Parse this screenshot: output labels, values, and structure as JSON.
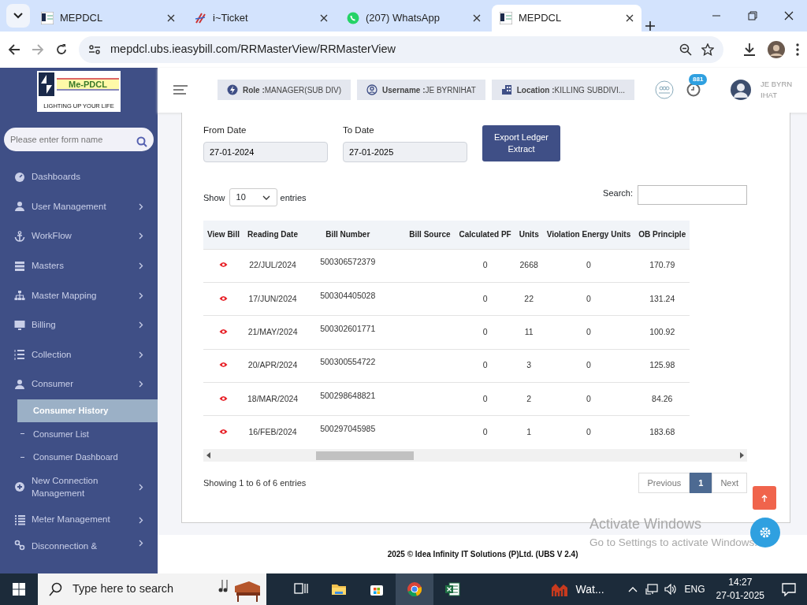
{
  "browser": {
    "tabs": [
      {
        "title": "MEPDCL",
        "selected": false
      },
      {
        "title": "i~Ticket",
        "selected": false
      },
      {
        "title": "(207) WhatsApp",
        "selected": false
      },
      {
        "title": "MEPDCL",
        "selected": true
      }
    ],
    "url": "mepdcl.ubs.ieasybill.com/RRMasterView/RRMasterView"
  },
  "sidebar": {
    "logo_text": "Me-PDCL",
    "logo_tagline": "LIGHTING UP YOUR LIFE",
    "search_placeholder": "Please enter form name",
    "items": [
      {
        "label": "Dashboards",
        "has_submenu": false
      },
      {
        "label": "User Management",
        "has_submenu": true
      },
      {
        "label": "WorkFlow",
        "has_submenu": true
      },
      {
        "label": "Masters",
        "has_submenu": true
      },
      {
        "label": "Master Mapping",
        "has_submenu": true
      },
      {
        "label": "Billing",
        "has_submenu": true
      },
      {
        "label": "Collection",
        "has_submenu": true
      },
      {
        "label": "Consumer",
        "has_submenu": true,
        "expanded": true,
        "children": [
          {
            "label": "Consumer History",
            "selected": true
          },
          {
            "label": "Consumer List",
            "selected": false
          },
          {
            "label": "Consumer Dashboard",
            "selected": false
          }
        ]
      },
      {
        "label": "New Connection Management",
        "has_submenu": true
      },
      {
        "label": "Meter Management",
        "has_submenu": true
      },
      {
        "label": "Disconnection &",
        "has_submenu": true
      }
    ]
  },
  "header": {
    "chips": [
      {
        "label": "Role :",
        "value": "MANAGER(SUB DIV)"
      },
      {
        "label": "Username :",
        "value": "JE BYRNIHAT"
      },
      {
        "label": "Location :",
        "value": "KILLING SUBDIVI..."
      }
    ],
    "notification_count": "881",
    "user_lines": [
      "JE BYRN",
      "IHAT"
    ]
  },
  "form": {
    "from_label": "From Date",
    "from_value": "27-01-2024",
    "to_label": "To Date",
    "to_value": "27-01-2025",
    "export_button": "Export Ledger Extract"
  },
  "table": {
    "show_label": "Show",
    "page_length": "10",
    "entries_label": "entries",
    "search_label": "Search:",
    "columns": [
      "View Bill",
      "Reading Date",
      "Bill Number",
      "Bill Source",
      "Calculated PF",
      "Units",
      "Violation Energy Units",
      "OB Principle"
    ],
    "rows": [
      {
        "reading_date": "22/JUL/2024",
        "bill_number": "500306572379",
        "calculated_pf": "0",
        "units": "2668",
        "violation_units": "0",
        "ob_principle": "170.79"
      },
      {
        "reading_date": "17/JUN/2024",
        "bill_number": "500304405028",
        "calculated_pf": "0",
        "units": "22",
        "violation_units": "0",
        "ob_principle": "131.24"
      },
      {
        "reading_date": "21/MAY/2024",
        "bill_number": "500302601771",
        "calculated_pf": "0",
        "units": "11",
        "violation_units": "0",
        "ob_principle": "100.92"
      },
      {
        "reading_date": "20/APR/2024",
        "bill_number": "500300554722",
        "calculated_pf": "0",
        "units": "3",
        "violation_units": "0",
        "ob_principle": "125.98"
      },
      {
        "reading_date": "18/MAR/2024",
        "bill_number": "500298648821",
        "calculated_pf": "0",
        "units": "2",
        "violation_units": "0",
        "ob_principle": "84.26"
      },
      {
        "reading_date": "16/FEB/2024",
        "bill_number": "500297045985",
        "calculated_pf": "0",
        "units": "1",
        "violation_units": "0",
        "ob_principle": "183.68"
      }
    ],
    "info": "Showing 1 to 6 of 6 entries",
    "previous": "Previous",
    "pages": [
      {
        "label": "1",
        "selected": true
      }
    ],
    "next": "Next"
  },
  "footer": "2025 © Idea Infinity IT Solutions (P)Ltd. (UBS V 2.4)",
  "activation_notice": {
    "title": "Activate Windows",
    "subtitle": "Go to Settings to activate Windows."
  },
  "taskbar": {
    "search_placeholder": "Type here to search",
    "tray_app": "Wat...",
    "language": "ENG",
    "time": "14:27",
    "date": "27-01-2025"
  }
}
